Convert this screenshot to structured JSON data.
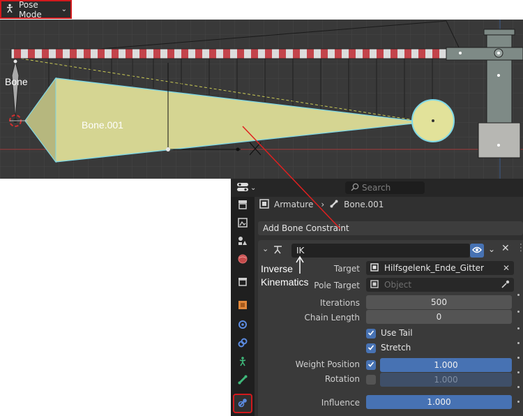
{
  "mode_selector": {
    "label": "Pose Mode",
    "icon": "pose-mode-icon"
  },
  "viewport": {
    "bone_label": "Bone",
    "bone001_label": "Bone.001"
  },
  "properties": {
    "search_placeholder": "Search",
    "breadcrumb": {
      "object": "Armature",
      "bone": "Bone.001"
    },
    "add_constraint_label": "Add Bone Constraint",
    "constraint": {
      "name": "IK",
      "annotation_line1": "Inverse",
      "annotation_line2": "Kinematics",
      "target_label": "Target",
      "target_value": "Hilfsgelenk_Ende_Gitter",
      "pole_target_label": "Pole Target",
      "pole_target_placeholder": "Object",
      "iterations_label": "Iterations",
      "iterations_value": "500",
      "chain_length_label": "Chain Length",
      "chain_length_value": "0",
      "use_tail_label": "Use Tail",
      "stretch_label": "Stretch",
      "weight_position_label": "Weight Position",
      "weight_position_value": "1.000",
      "rotation_label": "Rotation",
      "rotation_value": "1.000",
      "influence_label": "Influence",
      "influence_value": "1.000"
    }
  },
  "colors": {
    "accent_blue": "#4772b3",
    "highlight_red": "#d0191c",
    "bone_fill": "#d5d592"
  }
}
